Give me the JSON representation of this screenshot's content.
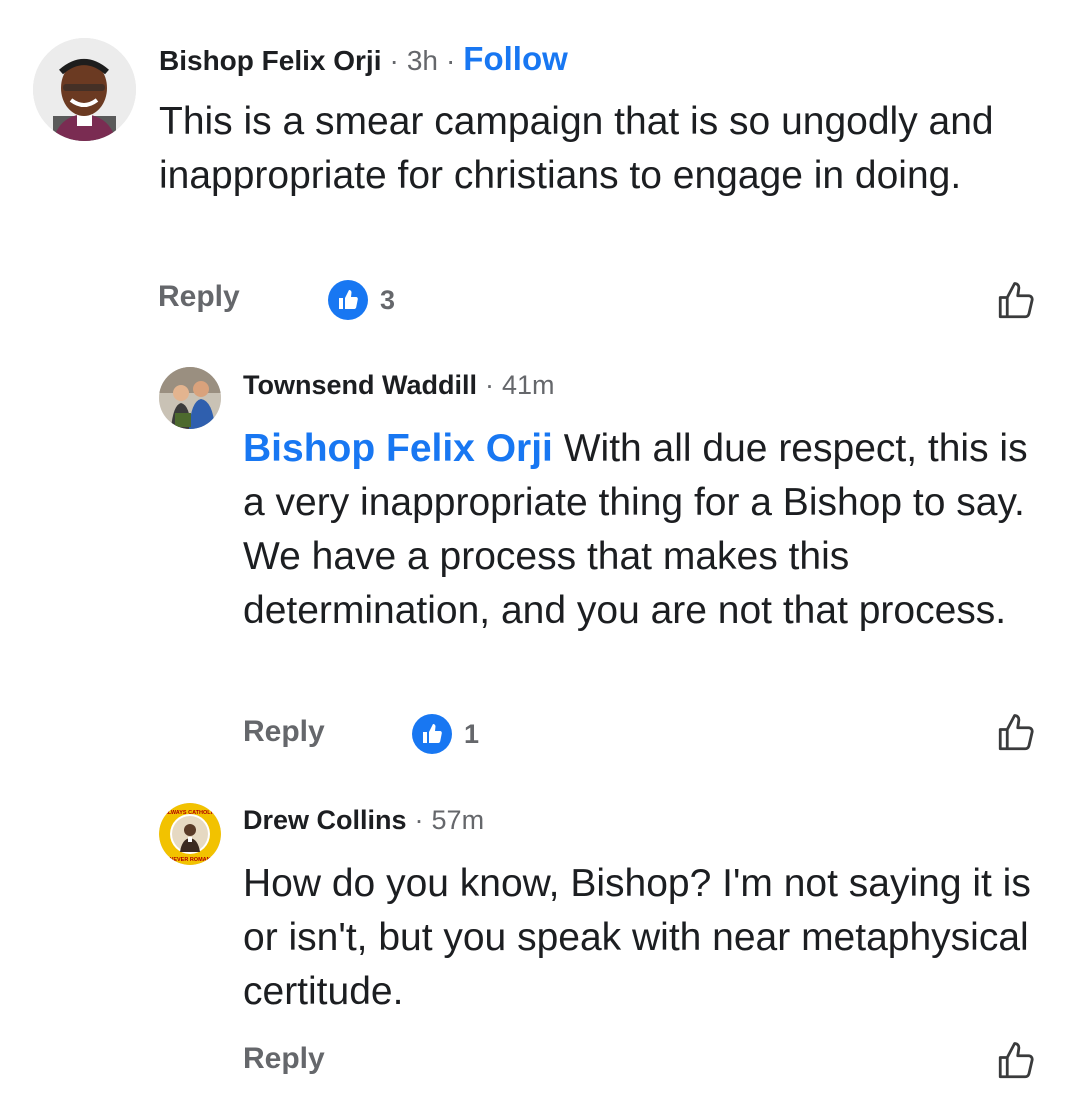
{
  "comments": [
    {
      "author": "Bishop Felix Orji",
      "separator": "·",
      "time": "3h",
      "separator2": "·",
      "follow_label": "Follow",
      "text": "This is a smear campaign that is so ungodly and inappropriate for christians to engage in doing.",
      "reply_label": "Reply",
      "like_count": "3",
      "avatar_icon": "profile-photo"
    }
  ],
  "replies": [
    {
      "author": "Townsend Waddill",
      "separator": "·",
      "time": "41m",
      "mention": "Bishop Felix Orji",
      "text": " With all due respect, this is a very inappropriate thing for a Bishop to say. We have a process that makes this determination, and you are not that process.",
      "reply_label": "Reply",
      "like_count": "1",
      "avatar_icon": "profile-photo"
    },
    {
      "author": "Drew Collins",
      "separator": "·",
      "time": "57m",
      "text": "How do you know, Bishop? I'm not saying it is or isn't, but you speak with near metaphysical certitude.",
      "reply_label": "Reply",
      "avatar_icon": "profile-badge",
      "avatar_ring_text_top": "ALWAYS CATHOLIC",
      "avatar_ring_text_bottom": "NEVER ROMAN"
    }
  ],
  "colors": {
    "link": "#1877f2",
    "text": "#1c1e21",
    "secondary": "#65676b",
    "like_badge": "#1877f2"
  },
  "icons": {
    "like_badge": "thumbs-up-icon",
    "like_action": "thumbs-up-outline-icon"
  }
}
